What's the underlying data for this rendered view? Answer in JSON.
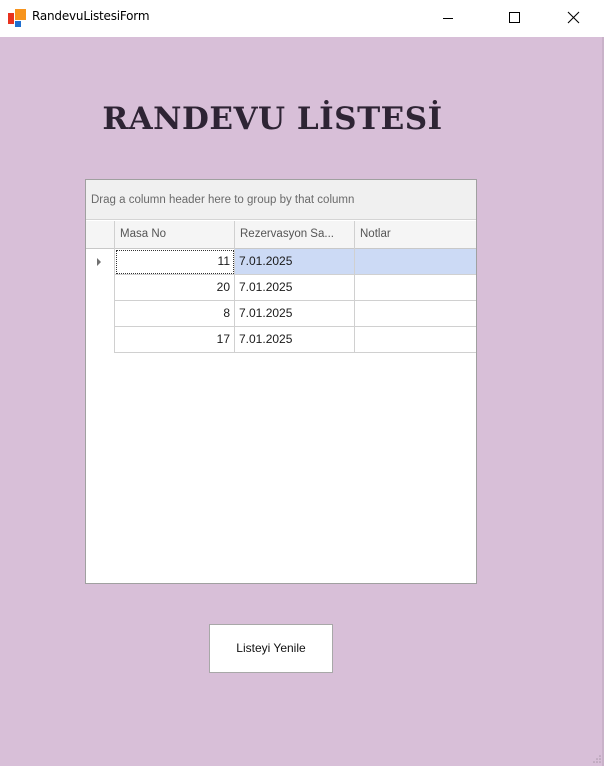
{
  "window": {
    "title": "RandevuListesiForm",
    "controls": [
      "minimize",
      "maximize",
      "close"
    ]
  },
  "form": {
    "heading": "RANDEVU LİSTESİ"
  },
  "grid": {
    "group_panel_text": "Drag a column header here to group by that column",
    "columns": [
      "Masa No",
      "Rezervasyon Sa...",
      "Notlar"
    ],
    "rows": [
      {
        "masa_no": "11",
        "rezervasyon": "7.01.2025",
        "notlar": ""
      },
      {
        "masa_no": "20",
        "rezervasyon": "7.01.2025",
        "notlar": ""
      },
      {
        "masa_no": "8",
        "rezervasyon": "7.01.2025",
        "notlar": ""
      },
      {
        "masa_no": "17",
        "rezervasyon": "7.01.2025",
        "notlar": ""
      }
    ],
    "selected_row": 0
  },
  "buttons": {
    "refresh_label": "Listeyi Yenile"
  },
  "colors": {
    "form_background": "#d8bfd8",
    "selection": "#ccdaf5",
    "heading": "#2e2434"
  }
}
